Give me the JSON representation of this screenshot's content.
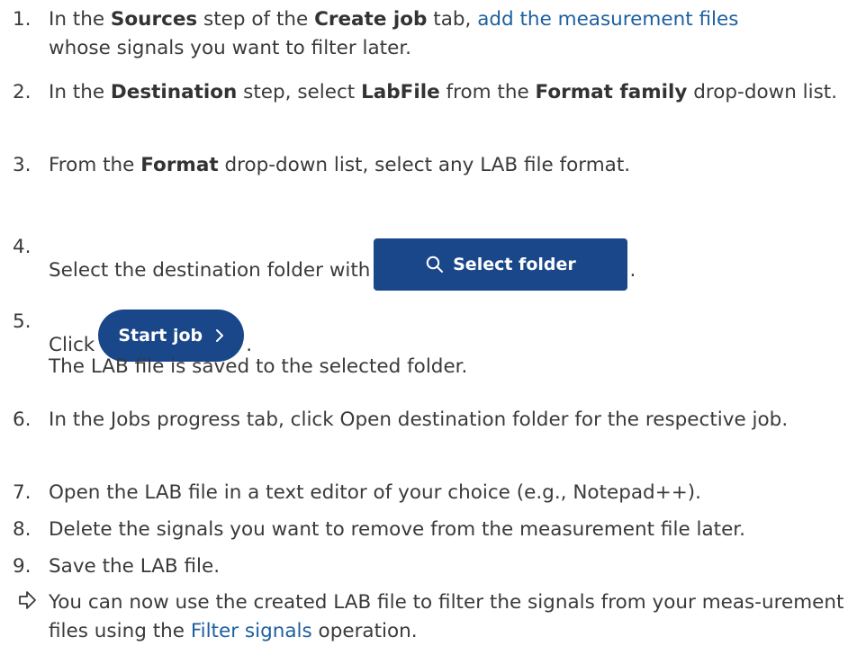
{
  "steps": [
    {
      "num": "1.",
      "parts": [
        "In the ",
        "Sources",
        " step of the ",
        "Create job",
        " tab, ",
        "add the measurement files",
        " whose signals you want to filter later."
      ]
    },
    {
      "num": "2.",
      "parts": [
        "In the ",
        "Destination",
        " step, select ",
        "LabFile",
        " from the ",
        "Format family",
        " drop-down list."
      ]
    },
    {
      "num": "3.",
      "parts": [
        "From the ",
        "Format",
        " drop-down list, select any LAB file format."
      ]
    },
    {
      "num": "4.",
      "text": "Select the destination folder with",
      "button_label": "Select folder",
      "button_icon": "search-icon",
      "trailing": "."
    },
    {
      "num": "5.",
      "text": "Click",
      "button_label": "Start job",
      "button_icon": "chevron-right-icon",
      "trailing": ".",
      "result": "The LAB file is saved to the selected folder."
    },
    {
      "num": "6.",
      "text": "In the Jobs progress tab, click Open destination folder for the respective job."
    },
    {
      "num": "7.",
      "text": "Open the LAB file in a text editor of your choice (e.g., Notepad++)."
    },
    {
      "num": "8.",
      "text": "Delete the signals you want to remove from the measurement file later."
    },
    {
      "num": "9.",
      "text": "Save the LAB file."
    }
  ],
  "result": {
    "icon": "arrow-right-outline-icon",
    "parts": [
      "You can now use the created LAB file to filter the signals from your meas-urement files using the ",
      "Filter signals",
      " operation."
    ]
  },
  "colors": {
    "text": "#3a3a3a",
    "link": "#1d5fa0",
    "button": "#1a468a"
  }
}
